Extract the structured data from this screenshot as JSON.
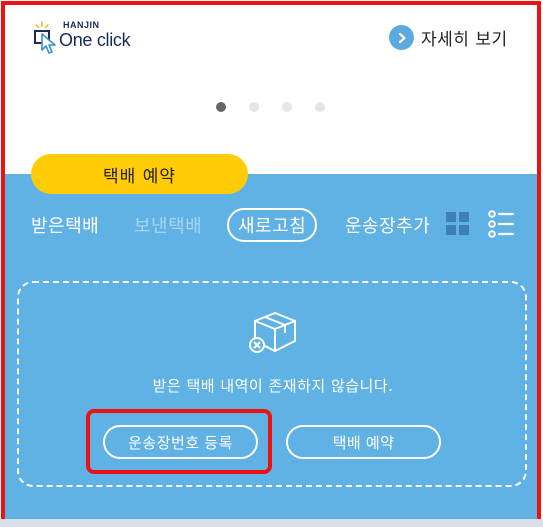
{
  "header": {
    "logo_small": "HANJIN",
    "logo_main_one": "One",
    "logo_main_click": " click",
    "detail_link_label": "자세히 보기"
  },
  "carousel": {
    "dots": 4,
    "active_index": 0
  },
  "booking_tab_label": "택배 예약",
  "tabs": {
    "received": "받은택배",
    "sent": "보낸택배",
    "refresh": "새로고침",
    "add_tracking": "운송장추가"
  },
  "empty_state": {
    "message": "받은 택배 내역이 존재하지 않습니다.",
    "register_button": "운송장번호 등록",
    "booking_button": "택배 예약"
  },
  "colors": {
    "panel_blue": "#60b2e5",
    "tab_yellow": "#ffcc05",
    "highlight_red": "#ee1111",
    "inactive_tab": "#a8d4f1"
  },
  "icons": {
    "logo": "hanjin-cursor-logo-icon",
    "detail": "chevron-right-circle-icon",
    "grid": "grid-view-icon",
    "list": "list-view-icon",
    "empty": "box-x-icon"
  }
}
